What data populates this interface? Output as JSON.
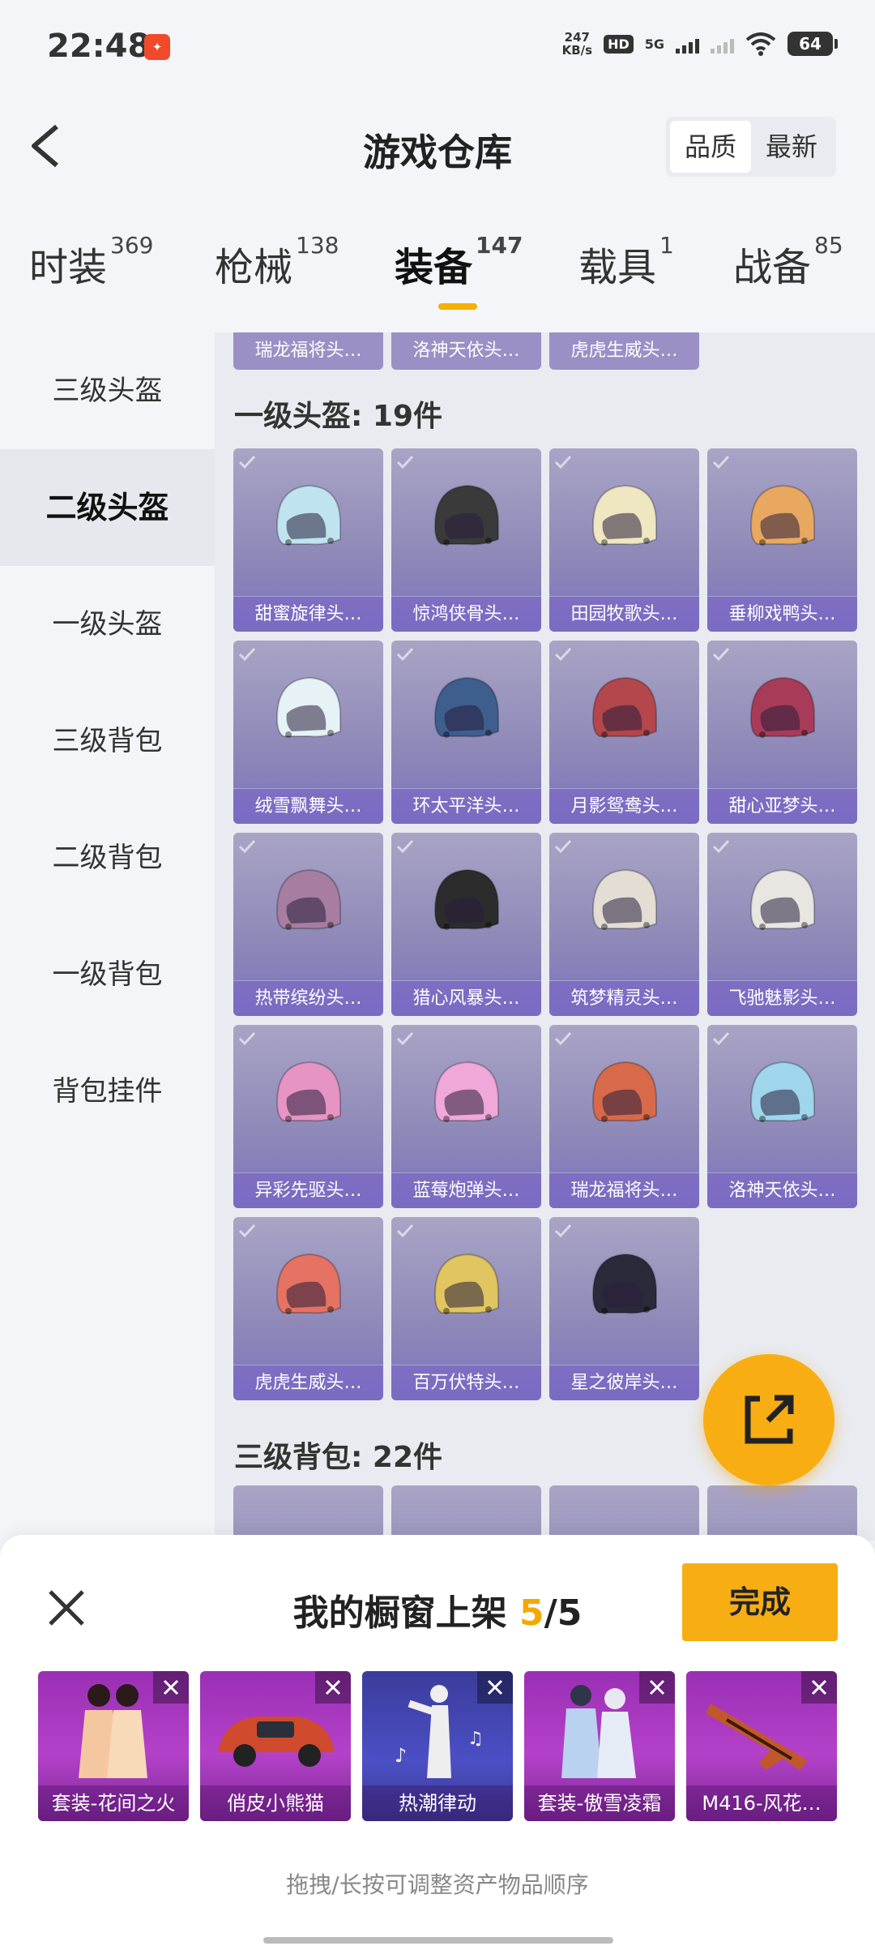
{
  "status_bar": {
    "time": "22:48",
    "net_speed": "247",
    "net_speed_unit": "KB/s",
    "hd": "HD",
    "signal_label": "5G",
    "battery": "64",
    "notif_icon": "red-app-icon"
  },
  "header": {
    "title": "游戏仓库",
    "sort_options": [
      "品质",
      "最新"
    ],
    "sort_active": "品质",
    "back_icon": "back-chevron-icon"
  },
  "tabs": [
    {
      "label": "时装",
      "count": "369"
    },
    {
      "label": "枪械",
      "count": "138"
    },
    {
      "label": "装备",
      "count": "147",
      "active": true
    },
    {
      "label": "载具",
      "count": "1"
    },
    {
      "label": "战备",
      "count": "85"
    }
  ],
  "subnav": [
    {
      "label": "三级头盔"
    },
    {
      "label": "二级头盔",
      "active": true
    },
    {
      "label": "一级头盔"
    },
    {
      "label": "三级背包"
    },
    {
      "label": "二级背包"
    },
    {
      "label": "一级背包"
    },
    {
      "label": "背包挂件"
    }
  ],
  "content": {
    "top_strip": [
      "瑞龙福将头…",
      "洛神天依头…",
      "虎虎生威头…"
    ],
    "section1_title": "一级头盔: 19件",
    "section1_items": [
      {
        "name": "甜蜜旋律头…",
        "color": "#bfe3ef"
      },
      {
        "name": "惊鸿侠骨头…",
        "color": "#3a3a3a"
      },
      {
        "name": "田园牧歌头…",
        "color": "#efe6c2"
      },
      {
        "name": "垂柳戏鸭头…",
        "color": "#e9a860"
      },
      {
        "name": "绒雪飘舞头…",
        "color": "#e6f2f6"
      },
      {
        "name": "环太平洋头…",
        "color": "#3e5e8e"
      },
      {
        "name": "月影鸳鸯头…",
        "color": "#b3474b"
      },
      {
        "name": "甜心亚梦头…",
        "color": "#a83c58"
      },
      {
        "name": "热带缤纷头…",
        "color": "#a77ea2"
      },
      {
        "name": "猎心风暴头…",
        "color": "#2c2c2c"
      },
      {
        "name": "筑梦精灵头…",
        "color": "#e3ddd3"
      },
      {
        "name": "飞驰魅影头…",
        "color": "#e8e6e0"
      },
      {
        "name": "异彩先驱头…",
        "color": "#e594c4"
      },
      {
        "name": "蓝莓炮弹头…",
        "color": "#f0a7d9"
      },
      {
        "name": "瑞龙福将头…",
        "color": "#d86a4a"
      },
      {
        "name": "洛神天依头…",
        "color": "#9fd6ec"
      },
      {
        "name": "虎虎生威头…",
        "color": "#e57262"
      },
      {
        "name": "百万伏特头…",
        "color": "#e0c560"
      },
      {
        "name": "星之彼岸头…",
        "color": "#2a2a3a"
      }
    ],
    "section2_title": "三级背包: 22件"
  },
  "share_icon": "share-external-icon",
  "sheet": {
    "title_prefix": "我的橱窗上架",
    "count_current": "5",
    "count_sep": "/",
    "count_total": "5",
    "done_label": "完成",
    "close_icon": "close-icon",
    "items": [
      {
        "label": "套装-花间之火",
        "theme": "purple"
      },
      {
        "label": "俏皮小熊猫",
        "theme": "purple"
      },
      {
        "label": "热潮律动",
        "theme": "blue"
      },
      {
        "label": "套装-傲雪凌霜",
        "theme": "purple"
      },
      {
        "label": "M416-风花…",
        "theme": "purple"
      }
    ],
    "hint": "拖拽/长按可调整资产物品顺序"
  }
}
